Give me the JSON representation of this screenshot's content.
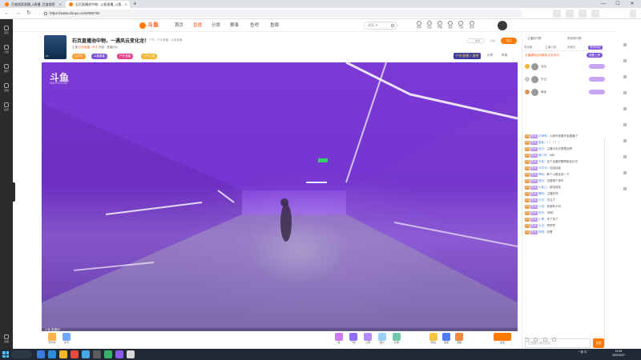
{
  "browser": {
    "tabs": [
      {
        "label": "百度搜索直播_8直播_百度搜索"
      },
      {
        "label": "石页直播池中物...斗鱼直播_斗鱼..."
      }
    ],
    "new_tab": "+",
    "url": "https://www.douyu.com/565792"
  },
  "rail": {
    "items": [
      {
        "label": "首页"
      },
      {
        "label": "分类"
      },
      {
        "label": "娱乐"
      },
      {
        "label": "赛事"
      },
      {
        "label": "鱼吧"
      }
    ],
    "bottom": "客服"
  },
  "nav": {
    "logo": "斗鱼",
    "links": [
      "首页",
      "直播",
      "分类",
      "赛事",
      "鱼吧",
      "鱼眼"
    ],
    "search_placeholder": "搜索 ▼",
    "icons": [
      {
        "icon": "history-icon",
        "label": "历史"
      },
      {
        "icon": "follow-icon",
        "label": "关注"
      },
      {
        "icon": "live-icon",
        "label": "开播"
      },
      {
        "icon": "message-icon",
        "label": "消息"
      },
      {
        "icon": "download-icon",
        "label": "下载"
      },
      {
        "icon": "task-icon",
        "label": "任务"
      }
    ]
  },
  "room": {
    "title": "石页直播池中物，一遇风云变化龙！",
    "tags_crumb": "推荐 · 户外 · 户外直播 · 斗鱼直播",
    "meta_prefix": "主播",
    "anchor_level": "LV",
    "anchor_name": "石页直播 · 呜卡",
    "meta_suffix": "热度 · 直播时长",
    "badges": [
      "口户外",
      "斗鱼新星",
      "户外宝藏",
      "人气主播"
    ],
    "rank_label": "户外直播 7 周榜",
    "stats": [
      "分享",
      "举报"
    ],
    "report": "◯ 举报",
    "share": "分享",
    "follow": "关注"
  },
  "video": {
    "logo": "斗鱼",
    "logo_sub": "DOUYU.COM",
    "bottom_text": "斗鱼 直播间"
  },
  "gifts": [
    {
      "label": "荧光棒"
    },
    {
      "label": "办卡"
    },
    {
      "label": "赞"
    },
    {
      "label": "飞机"
    },
    {
      "label": "火箭"
    },
    {
      "label": "超火"
    },
    {
      "label": "礼物"
    },
    {
      "label": "粉丝"
    },
    {
      "label": "贵族"
    },
    {
      "label": "宝箱"
    },
    {
      "label": "充值"
    }
  ],
  "chat": {
    "tabs": [
      "主播排行榜",
      "贵宾排行榜"
    ],
    "subtabs": [
      "周贡献",
      "主播小团",
      "房管队",
      "贵宾排名"
    ],
    "notice": "主播通知活动赛事 正在参与",
    "notice_btn": "我要上榜",
    "ranks": [
      {
        "name": "龙龙"
      },
      {
        "name": "不过"
      },
      {
        "name": "萌宝"
      }
    ],
    "messages": [
      {
        "lv": "LV",
        "fan": "粉丝",
        "user": "花海啊",
        "text": "大家好准备开始直播了"
      },
      {
        "lv": "LV",
        "fan": "粉丝",
        "user": "星星",
        "text": "！！！！！"
      },
      {
        "lv": "LV",
        "fan": "粉丝",
        "user": "宝贝",
        "text": "主播今天去哪里玩啊"
      },
      {
        "lv": "LV",
        "fan": "粉丝",
        "user": "路人甲",
        "text": "666"
      },
      {
        "lv": "LV",
        "fan": "粉丝",
        "user": "天蓝",
        "text": "这个走廊好酷啊紫色灯光"
      },
      {
        "lv": "LV",
        "fan": "粉丝",
        "user": "冲冲冲",
        "text": "加油加油"
      },
      {
        "lv": "LV",
        "fan": "粉丝",
        "user": "啊哈",
        "text": "刷个火箭支持一下"
      },
      {
        "lv": "LV",
        "fan": "粉丝",
        "user": "星河",
        "text": "这是哪个城市"
      },
      {
        "lv": "LV",
        "fan": "粉丝",
        "user": "小鱼儿",
        "text": "哈哈哈哈"
      },
      {
        "lv": "LV",
        "fan": "粉丝",
        "user": "暖阳",
        "text": "主播好帅"
      },
      {
        "lv": "LV",
        "fan": "粉丝",
        "user": "月光",
        "text": "关注了"
      },
      {
        "lv": "LV",
        "fan": "粉丝",
        "user": "小张",
        "text": "前面有人吗"
      },
      {
        "lv": "LV",
        "fan": "粉丝",
        "user": "阿杰",
        "text": "冲鸭！"
      },
      {
        "lv": "LV",
        "fan": "粉丝",
        "user": "小黑",
        "text": "来了来了"
      },
      {
        "lv": "LV",
        "fan": "粉丝",
        "user": "大白",
        "text": "赞赞赞"
      },
      {
        "lv": "LV",
        "fan": "粉丝",
        "user": "阿明",
        "text": "好看"
      }
    ],
    "input_placeholder": "这里输入聊天内容",
    "send": "发送"
  },
  "taskbar": {
    "tray": "^ 英 中",
    "time": "19:34",
    "date": "2022/3/27"
  },
  "colors": {
    "accent": "#ff7a00",
    "brand_orange": "#ff5d23",
    "purple": "#7a54d6"
  }
}
